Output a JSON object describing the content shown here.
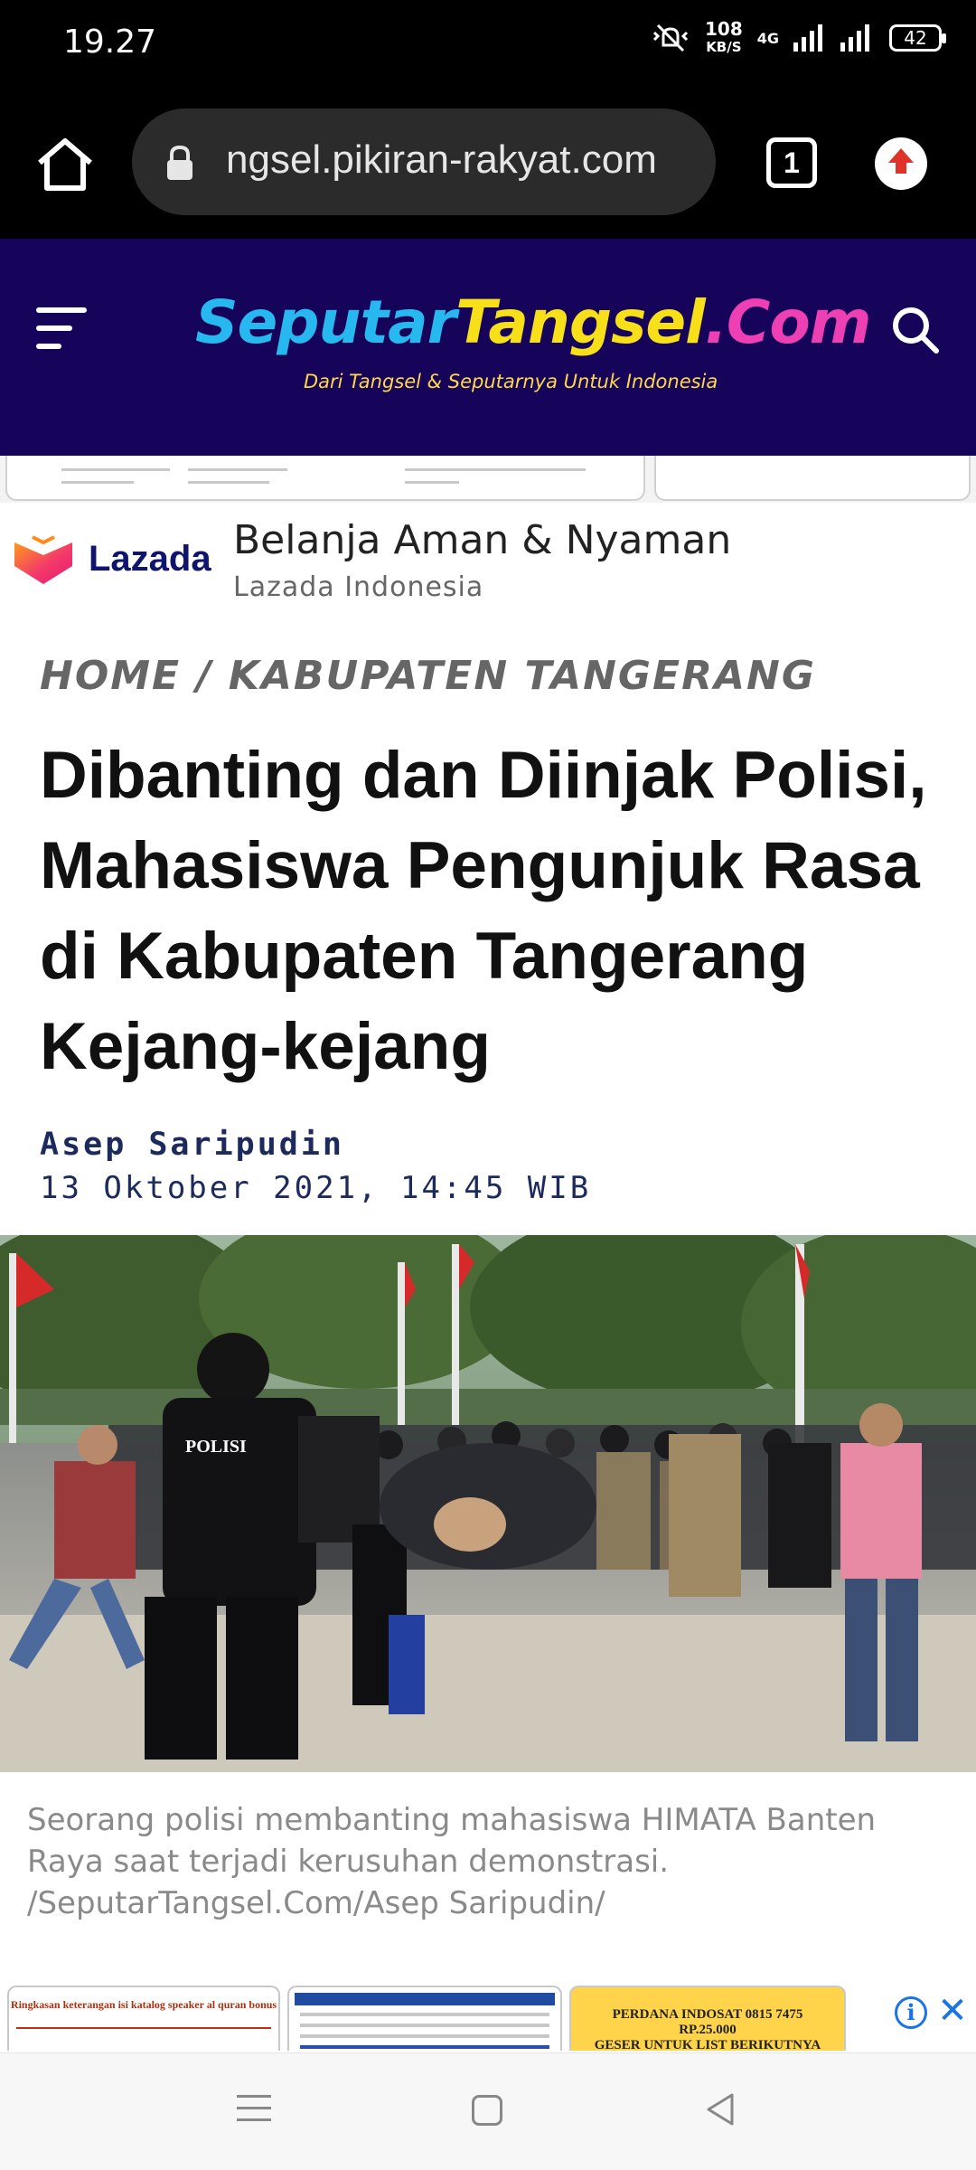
{
  "status_bar": {
    "time": "19.27",
    "net_speed": "108",
    "net_speed_unit": "KB/S",
    "network_type": "4G",
    "battery": "42"
  },
  "browser": {
    "url": "ngsel.pikiran-rakyat.com",
    "tab_count": "1"
  },
  "site": {
    "logo_part1": "Seputar",
    "logo_part2": "Tangsel",
    "logo_part3": ".Com",
    "tagline": "Dari Tangsel & Seputarnya Untuk Indonesia",
    "colors": {
      "header_bg": "#16045a",
      "logo_blue": "#28b8f0",
      "logo_yellow": "#f7e01a",
      "logo_pink": "#ef3fb5"
    }
  },
  "ad": {
    "brand": "Lazada",
    "title": "Belanja Aman & Nyaman",
    "subtitle": "Lazada Indonesia"
  },
  "article": {
    "breadcrumb": "HOME / KABUPATEN TANGERANG",
    "headline": "Dibanting dan Diinjak Polisi, Mahasiswa Pengunjuk Rasa di Kabupaten Tangerang Kejang-kejang",
    "author": "Asep Saripudin",
    "date": "13 Oktober 2021, 14:45 WIB",
    "photo_vest_label": "POLISI",
    "caption": "Seorang polisi membanting mahasiswa HIMATA Banten Raya saat terjadi kerusuhan demonstrasi. /SeputarTangsel.Com/Asep Saripudin/"
  },
  "bottom_ad": {
    "thumb1_text": "Ringkasan keterangan isi katalog speaker al quran bonus",
    "thumb3_line1": "PERDANA INDOSAT 0815 7475",
    "thumb3_line2": "RP.25.000",
    "thumb3_line3": "GESER UNTUK LIST BERIKUTNYA",
    "info_icon": "i",
    "close_icon": "✕"
  }
}
